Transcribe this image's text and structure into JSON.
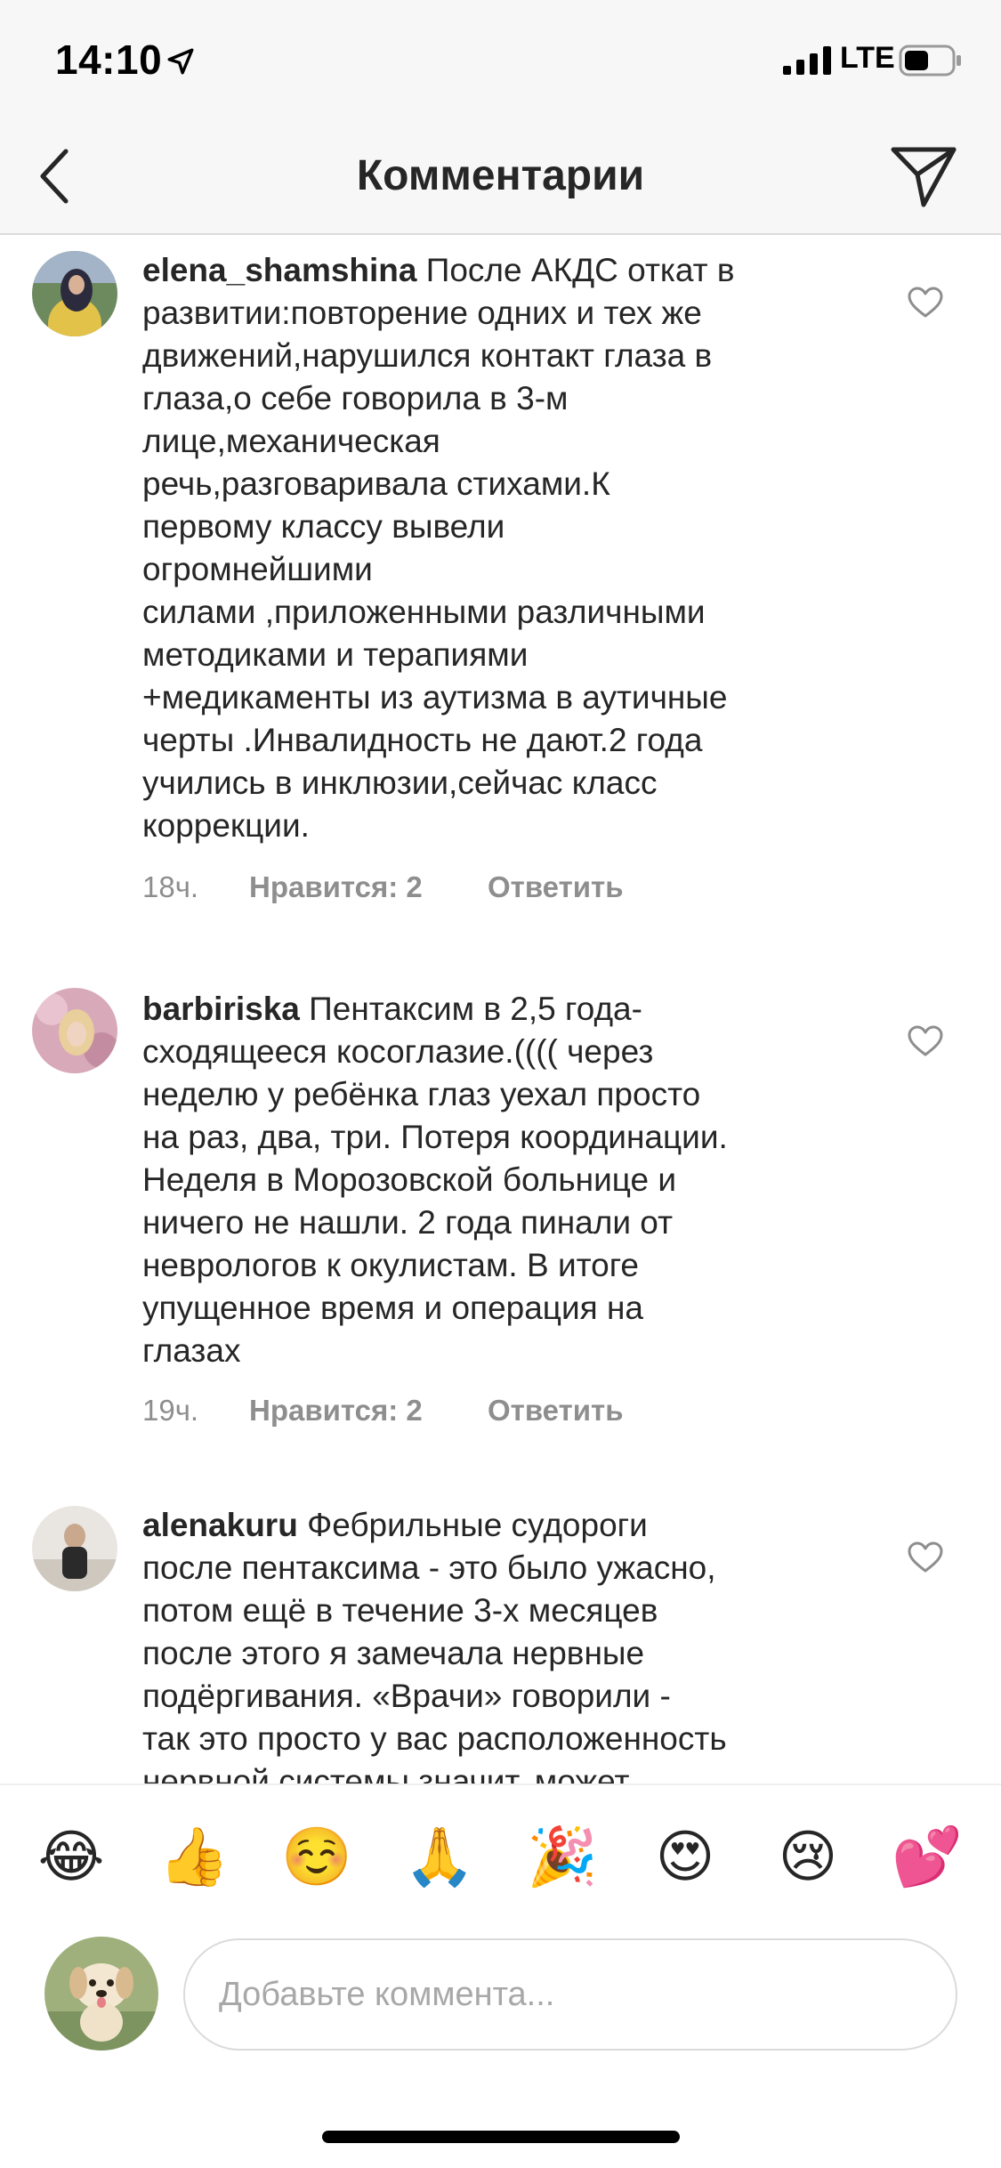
{
  "status_bar": {
    "time": "14:10",
    "network": "LTE"
  },
  "header": {
    "title": "Комментарии"
  },
  "comments": [
    {
      "username": "elena_shamshina",
      "lines": [
        "После АКДС откат в",
        "развитии:повторение одних и тех же",
        "движений,нарушился контакт глаза в",
        "глаза,о себе говорила в 3-м",
        "лице,механическая",
        "речь,разговаривала стихами.К",
        "первому классу вывели",
        "огромнейшими",
        "силами ,приложенными различными",
        "методиками и терапиями",
        "+медикаменты из аутизма в аутичные",
        "черты .Инвалидность не дают.2 года",
        "учились в инклюзии,сейчас класс",
        "коррекции."
      ],
      "time": "18ч.",
      "likes": "Нравится: 2",
      "reply": "Ответить"
    },
    {
      "username": "barbiriska",
      "lines": [
        "Пентаксим в 2,5 года-",
        "сходящееся косоглазие.(((( через",
        "неделю у ребёнка глаз уехал просто",
        "на раз, два, три. Потеря координации.",
        "Неделя в Морозовской больнице и",
        "ничего не нашли. 2 года пинали от",
        "неврологов к окулистам. В итоге",
        "упущенное время и операция на",
        "глазах"
      ],
      "time": "19ч.",
      "likes": "Нравится: 2",
      "reply": "Ответить"
    },
    {
      "username": "alenakuru",
      "lines": [
        "Фебрильные судороги",
        "после пентаксима - это было ужасно,",
        "потом ещё в течение 3-х месяцев",
        "после этого я замечала нервные",
        "подёргивания. «Врачи» говорили -",
        "так это просто у вас расположенность",
        "нервной системы значит, может"
      ]
    }
  ],
  "emoji_bar": [
    "😂",
    "👍",
    "☺️",
    "🙏",
    "🎉",
    "😍",
    "😢",
    "💕"
  ],
  "composer": {
    "placeholder": "Добавьте коммента..."
  }
}
